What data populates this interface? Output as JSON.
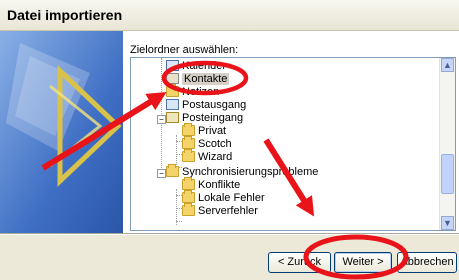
{
  "window": {
    "title": "Datei importieren"
  },
  "folder_picker": {
    "label": "Zielordner auswählen:",
    "items": [
      {
        "label": "Kalender",
        "icon": "calendar-icon"
      },
      {
        "label": "Kontakte",
        "icon": "contacts-folder-icon",
        "selected": true
      },
      {
        "label": "Notizen",
        "icon": "folder-icon"
      },
      {
        "label": "Postausgang",
        "icon": "outbox-icon"
      },
      {
        "label": "Posteingang",
        "icon": "inbox-icon",
        "expanded": true
      },
      {
        "label": "Privat",
        "icon": "folder-icon"
      },
      {
        "label": "Scotch",
        "icon": "folder-icon"
      },
      {
        "label": "Wizard",
        "icon": "folder-icon"
      },
      {
        "label": "Synchronisierungsprobleme",
        "icon": "folder-icon",
        "expanded": true
      },
      {
        "label": "Konflikte",
        "icon": "folder-icon"
      },
      {
        "label": "Lokale Fehler",
        "icon": "folder-icon"
      },
      {
        "label": "Serverfehler",
        "icon": "folder-icon"
      }
    ]
  },
  "buttons": {
    "back": "< Zurück",
    "next": "Weiter >",
    "cancel": "Abbrechen"
  },
  "annotation_color": "#e8141a"
}
